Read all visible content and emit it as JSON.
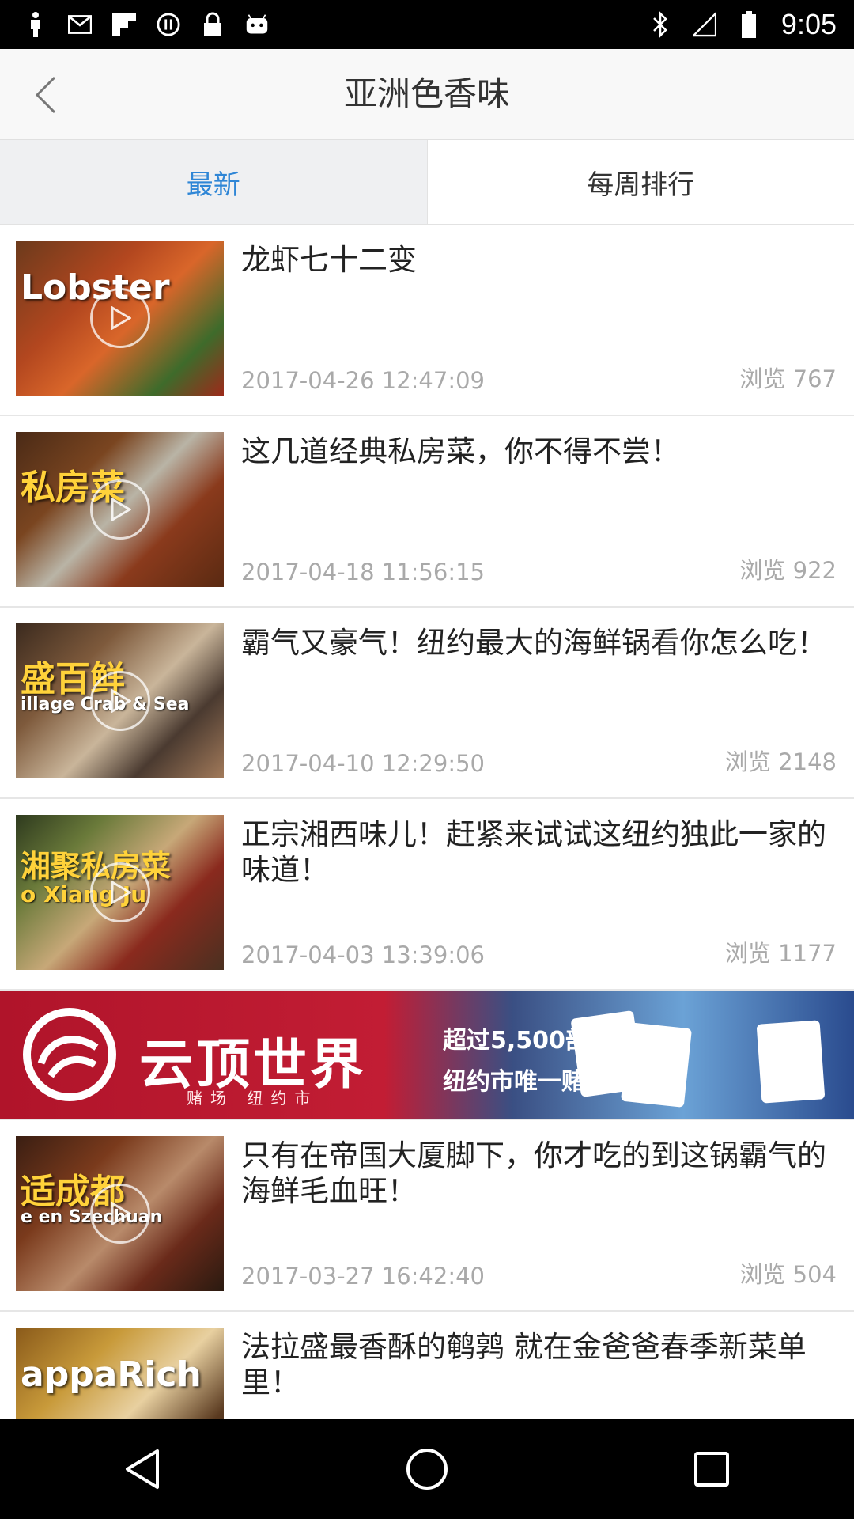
{
  "status_bar": {
    "time": "9:05"
  },
  "header": {
    "title": "亚洲色香味"
  },
  "tabs": [
    {
      "label": "最新",
      "active": true
    },
    {
      "label": "每周排行",
      "active": false
    }
  ],
  "items": [
    {
      "title": "龙虾七十二变",
      "date": "2017-04-26 12:47:09",
      "views": "浏览 767",
      "thumb_text": "Lobster"
    },
    {
      "title": "这几道经典私房菜，你不得不尝！",
      "date": "2017-04-18 11:56:15",
      "views": "浏览 922",
      "thumb_text": "私房菜"
    },
    {
      "title": "霸气又豪气！纽约最大的海鲜锅看你怎么吃！",
      "date": "2017-04-10 12:29:50",
      "views": "浏览 2148",
      "thumb_text": "盛百鲜",
      "thumb_sub": "illage Crab & Sea"
    },
    {
      "title": "正宗湘西味儿！赶紧来试试这纽约独此一家的味道！",
      "date": "2017-04-03 13:39:06",
      "views": "浏览 1177",
      "thumb_text": "湘聚私房菜",
      "thumb_sub": "o Xiang Ju"
    },
    {
      "title": "只有在帝国大厦脚下，你才吃的到这锅霸气的海鲜毛血旺！",
      "date": "2017-03-27 16:42:40",
      "views": "浏览 504",
      "thumb_text": "适成都",
      "thumb_sub": "e en Szechuan"
    },
    {
      "title": "法拉盛最香酥的鹌鹑 就在金爸爸春季新菜单里！",
      "thumb_text": "appaRich"
    }
  ],
  "ad": {
    "brand": "云顶世界",
    "sub": "赌场 纽约市",
    "line1": "超过5,500部游戏,",
    "line2": "纽约市唯一赌场!"
  },
  "colors": {
    "accent": "#2f86d6",
    "meta_gray": "#a9a9a9"
  }
}
